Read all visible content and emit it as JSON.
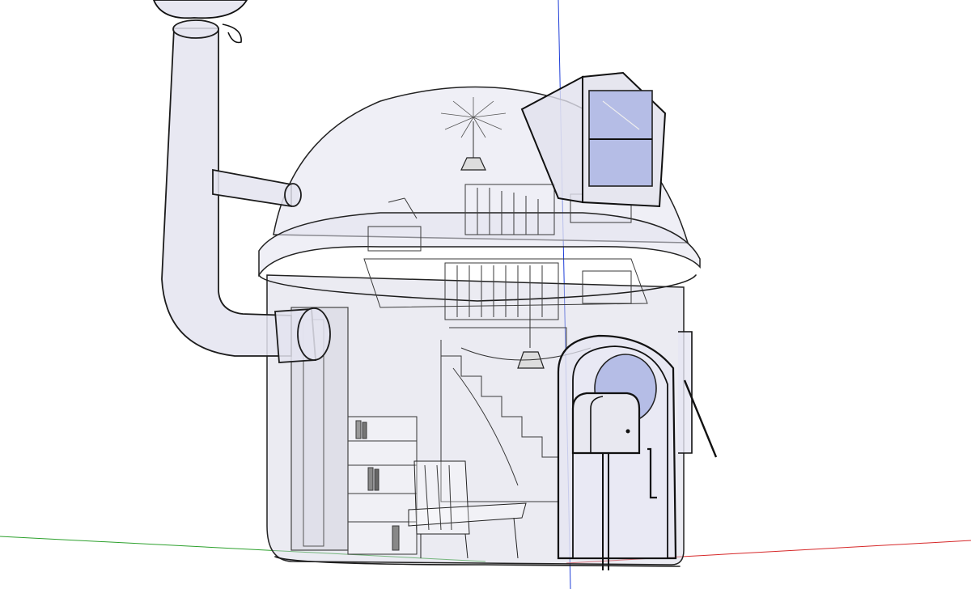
{
  "viewport": {
    "background": "#ffffff",
    "axes": {
      "red": "#d62728",
      "green": "#2ca02c",
      "blue": "#1f3fd8"
    }
  },
  "model": {
    "style": "x-ray",
    "face_color": "#d4d4e4",
    "edge_color": "#1c1c1c",
    "glass_color": "#b5bde6",
    "icons": [
      "dome-house-model",
      "chimney-pipe",
      "dormer-window",
      "round-door",
      "mailbox",
      "bookshelf",
      "armchair",
      "pendant-lamp",
      "staircase",
      "balcony-railing"
    ]
  }
}
